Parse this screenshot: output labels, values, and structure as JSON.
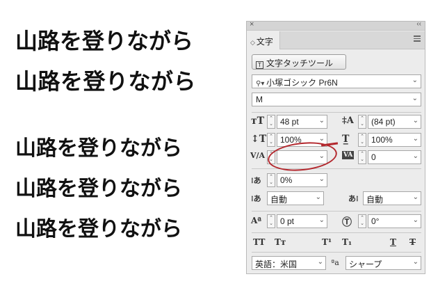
{
  "sample_lines": [
    "山路を登りながら",
    "山路を登りながら",
    "山路を登りながら",
    "山路を登りながら",
    "山路を登りながら"
  ],
  "panel": {
    "close_glyph": "×",
    "collapse_glyph": "‹‹",
    "tab_arrow": "◇",
    "tab_label": "文字",
    "touch_button_icon": "T",
    "touch_button_label": "文字タッチツール",
    "font_family": "小塚ゴシック Pr6N",
    "font_style": "M",
    "font_size": "48 pt",
    "leading": "(84 pt)",
    "vertical_scale": "100%",
    "horizontal_scale": "100%",
    "kerning": "",
    "tracking": "0",
    "tsume": "0%",
    "aki_left": "自動",
    "aki_right": "自動",
    "baseline_shift": "0 pt",
    "character_rotation": "0°",
    "typo_buttons": [
      "TT",
      "Tт",
      "T¹",
      "T₁",
      "T",
      "T"
    ],
    "language": "英語：米国",
    "aa_label": "ªa",
    "antialias": "シャープ"
  }
}
